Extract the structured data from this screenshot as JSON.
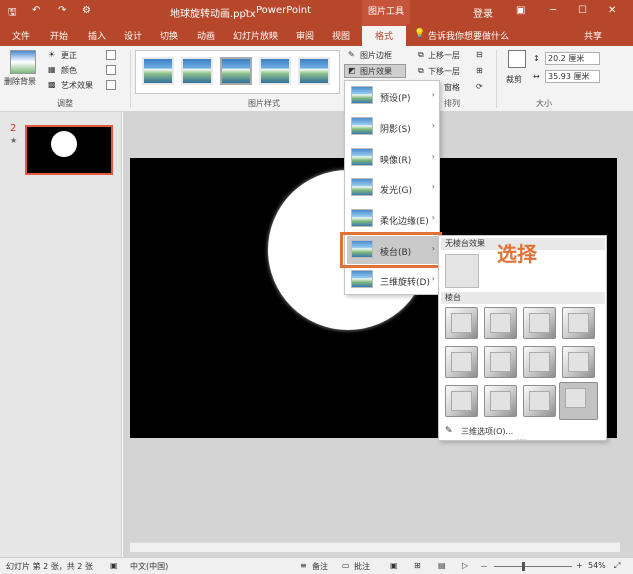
{
  "titlebar": {
    "filename": "地球旋转动画.pptx",
    "separator": "-",
    "app": "PowerPoint",
    "picture_tools": "图片工具",
    "login": "登录"
  },
  "menu": {
    "tabs": [
      "文件",
      "开始",
      "插入",
      "设计",
      "切换",
      "动画",
      "幻灯片放映",
      "审阅",
      "视图"
    ],
    "format_tab": "格式",
    "tell_me": "告诉我你想要做什么",
    "share": "共享"
  },
  "ribbon": {
    "remove_bg": "删除背景",
    "corrections": "更正",
    "color": "颜色",
    "artistic": "艺术效果",
    "adjust_group": "调整",
    "styles_group": "图片样式",
    "border": "图片边框",
    "effects": "图片效果",
    "bring_forward": "上移一层",
    "send_backward": "下移一层",
    "selection_pane": "窗格",
    "arrange_group": "排列",
    "crop": "裁剪",
    "height": "20.2 厘米",
    "width": "35.93 厘米",
    "size_group": "大小"
  },
  "thumbnail": {
    "number": "2",
    "star": "★"
  },
  "effects_menu": [
    {
      "label": "预设(P)",
      "arrow": "›"
    },
    {
      "label": "阴影(S)",
      "arrow": "›"
    },
    {
      "label": "映像(R)",
      "arrow": "›"
    },
    {
      "label": "发光(G)",
      "arrow": "›"
    },
    {
      "label": "柔化边缘(E)",
      "arrow": "›"
    },
    {
      "label": "棱台(B)",
      "arrow": "›"
    },
    {
      "label": "三维旋转(D)",
      "arrow": "›"
    }
  ],
  "bevel": {
    "no_bevel": "无棱台效果",
    "bevel_header": "棱台",
    "options_3d": "三维选项(O)...",
    "dots": "....."
  },
  "annotation": "选择",
  "status": {
    "slide": "幻灯片 第 2 张，共 2 张",
    "lang": "中文(中国)",
    "notes": "备注",
    "comments": "批注",
    "zoom": "54%",
    "minus": "－",
    "plus": "+"
  }
}
